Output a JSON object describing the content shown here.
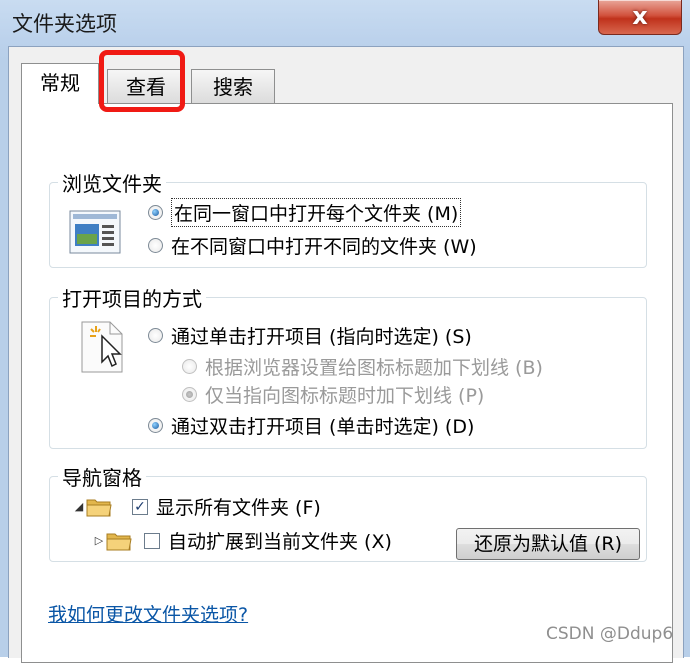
{
  "window": {
    "title": "文件夹选项",
    "close_glyph": "x"
  },
  "tabs": [
    {
      "label": "常规",
      "active": true
    },
    {
      "label": "查看",
      "active": false
    },
    {
      "label": "搜索",
      "active": false
    }
  ],
  "browse": {
    "title": "浏览文件夹",
    "options": [
      {
        "label": "在同一窗口中打开每个文件夹 (M)",
        "selected": true
      },
      {
        "label": "在不同窗口中打开不同的文件夹 (W)",
        "selected": false
      }
    ]
  },
  "open_items": {
    "title": "打开项目的方式",
    "single_click": "通过单击打开项目 (指向时选定) (S)",
    "underline_browser": "根据浏览器设置给图标标题加下划线 (B)",
    "underline_point": "仅当指向图标标题时加下划线 (P)",
    "double_click": "通过双击打开项目 (单击时选定) (D)"
  },
  "nav": {
    "title": "导航窗格",
    "show_all": {
      "label": "显示所有文件夹 (F)",
      "checked": true
    },
    "auto_expand": {
      "label": "自动扩展到当前文件夹 (X)",
      "checked": false
    }
  },
  "restore_button": "还原为默认值 (R)",
  "help_link": "我如何更改文件夹选项?",
  "watermark": "CSDN @Ddup6",
  "icons": [
    "close-icon",
    "window-preview-icon",
    "click-cursor-icon",
    "folder-icon",
    "tree-expanded-icon",
    "tree-collapsed-icon"
  ]
}
